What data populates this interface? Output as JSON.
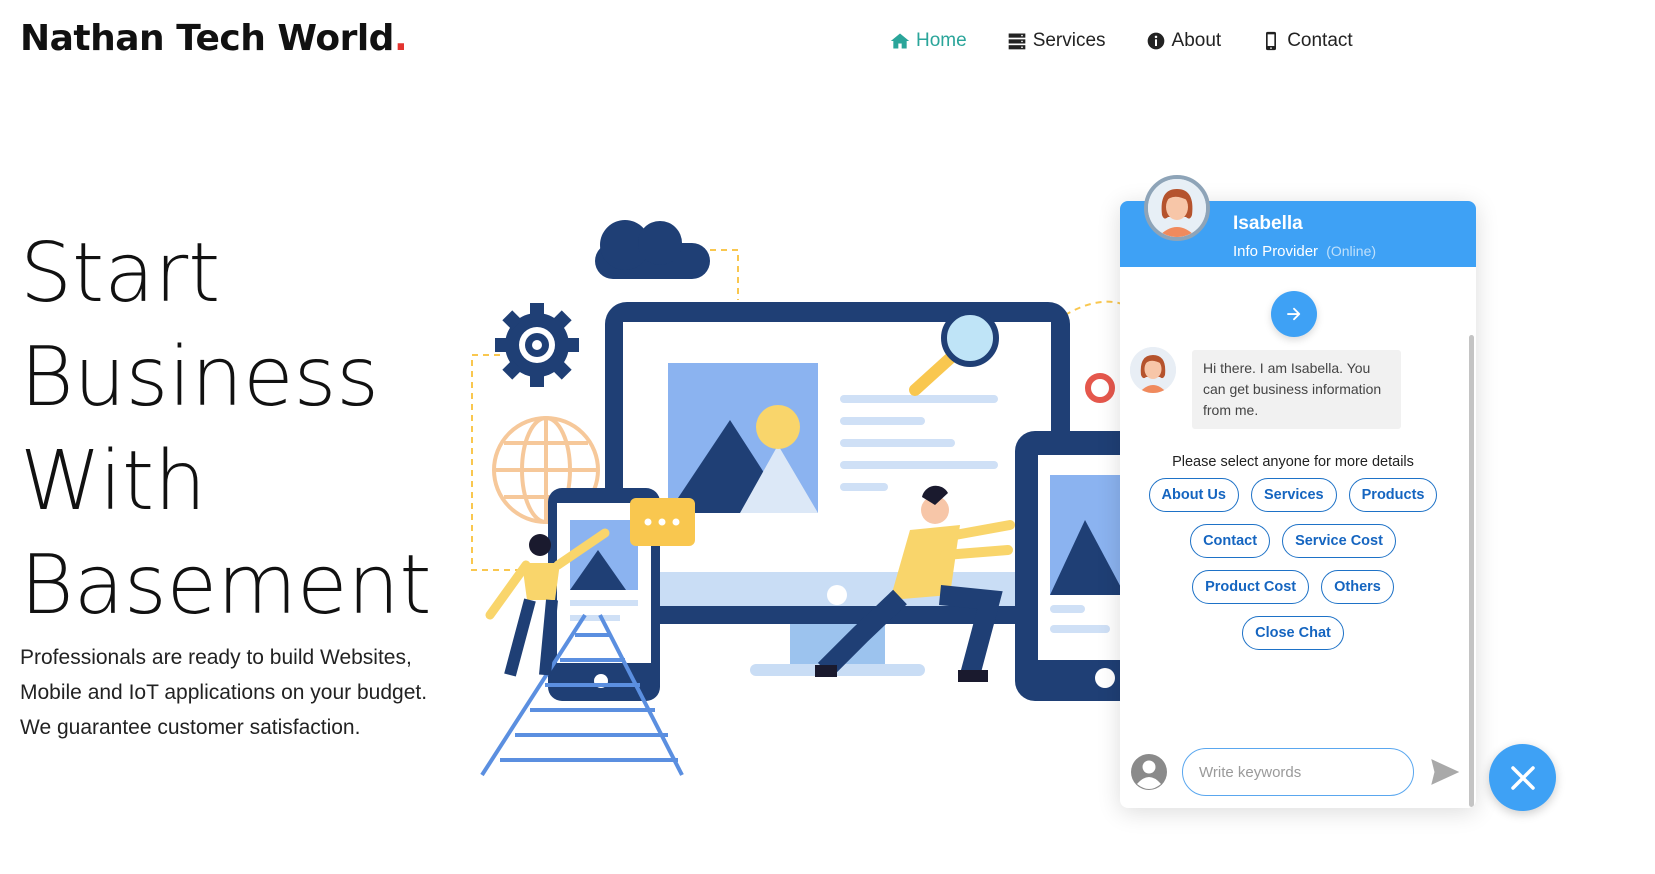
{
  "header": {
    "brand": "Nathan Tech World",
    "brand_dot": ".",
    "nav": [
      {
        "label": "Home",
        "icon": "home-icon",
        "active": true
      },
      {
        "label": "Services",
        "icon": "server-icon",
        "active": false
      },
      {
        "label": "About",
        "icon": "info-icon",
        "active": false
      },
      {
        "label": "Contact",
        "icon": "mobile-icon",
        "active": false
      }
    ]
  },
  "hero": {
    "title_lines": [
      "Start",
      "Business",
      "With",
      "Basement"
    ],
    "description": "Professionals are ready to build Websites, Mobile and IoT applications on your budget. We guarantee customer satisfaction."
  },
  "chat": {
    "agent_name": "Isabella",
    "agent_role": "Info Provider",
    "agent_status": "(Online)",
    "greeting": "Hi there. I am Isabella. You can get business information from me.",
    "prompt": "Please select anyone for more details",
    "options": [
      "About Us",
      "Services",
      "Products",
      "Contact",
      "Service Cost",
      "Product Cost",
      "Others",
      "Close Chat"
    ],
    "input_placeholder": "Write keywords"
  },
  "colors": {
    "accent": "#3ea1f5",
    "nav_active": "#2aa59a",
    "chip_border": "#1e72c7",
    "brand_dot": "#e3342f",
    "illustration_navy": "#1f3f75",
    "illustration_yellow": "#f9c74f"
  }
}
